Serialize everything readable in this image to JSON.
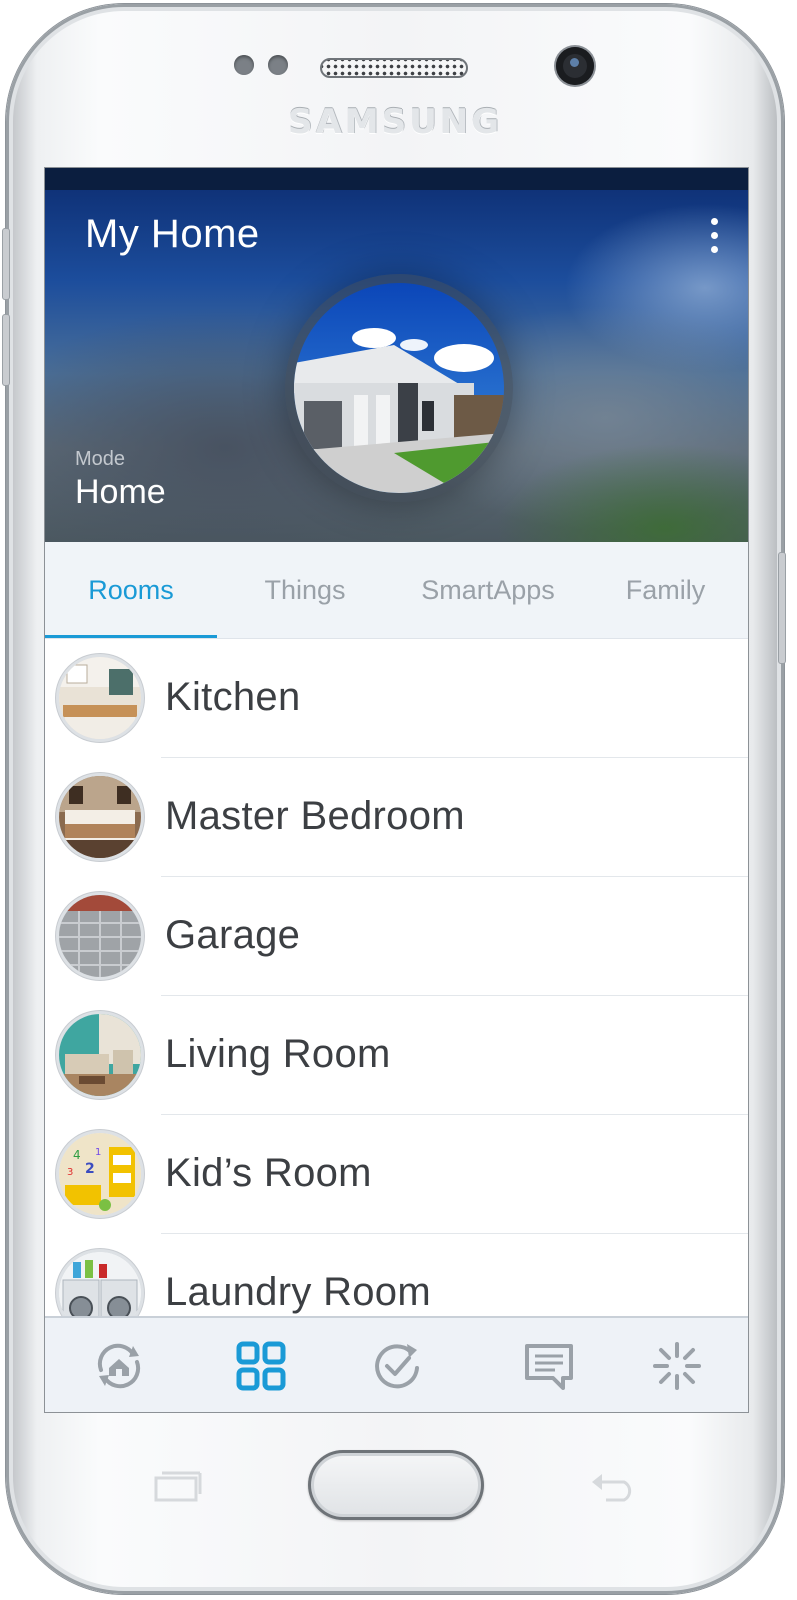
{
  "device": {
    "brand": "SAMSUNG"
  },
  "header": {
    "title": "My Home",
    "more_icon": "more-vertical-icon",
    "mode_label": "Mode",
    "mode_value": "Home"
  },
  "tabs": [
    {
      "label": "Rooms",
      "active": true
    },
    {
      "label": "Things",
      "active": false
    },
    {
      "label": "SmartApps",
      "active": false
    },
    {
      "label": "Family",
      "active": false
    }
  ],
  "rooms": [
    {
      "label": "Kitchen"
    },
    {
      "label": "Master Bedroom"
    },
    {
      "label": "Garage"
    },
    {
      "label": "Living Room"
    },
    {
      "label": "Kid’s Room"
    },
    {
      "label": "Laundry Room"
    }
  ],
  "bottom_nav": [
    {
      "icon": "home-dashboard-icon",
      "active": false
    },
    {
      "icon": "grid-icon",
      "active": true
    },
    {
      "icon": "routines-check-icon",
      "active": false
    },
    {
      "icon": "messages-icon",
      "active": false
    },
    {
      "icon": "marketplace-sparkle-icon",
      "active": false
    }
  ],
  "colors": {
    "accent": "#1a9ad6",
    "inactive": "#9aa1a8",
    "text": "#3c3f43"
  }
}
